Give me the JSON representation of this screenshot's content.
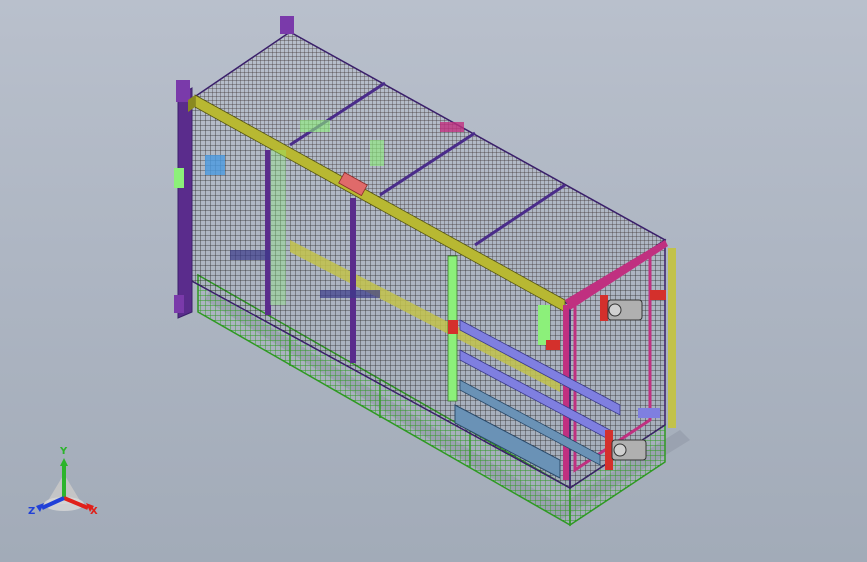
{
  "viewport": {
    "background_top": "#b9c0cc",
    "background_bottom": "#a2abb8"
  },
  "triad": {
    "x_label": "X",
    "y_label": "Y",
    "z_label": "Z",
    "x_color": "#e0201a",
    "y_color": "#2cb42c",
    "z_color": "#2040d8"
  },
  "model": {
    "mesh_color": "#2b2a2a",
    "top_frame_color": "#b8b832",
    "post_color": "#c03080",
    "base_mesh_color": "#2e9a22",
    "rail_color": "#7f7fe0",
    "end_panel_color": "#5a2c8c",
    "accent_red": "#d4302c",
    "accent_green": "#8cf07a"
  }
}
